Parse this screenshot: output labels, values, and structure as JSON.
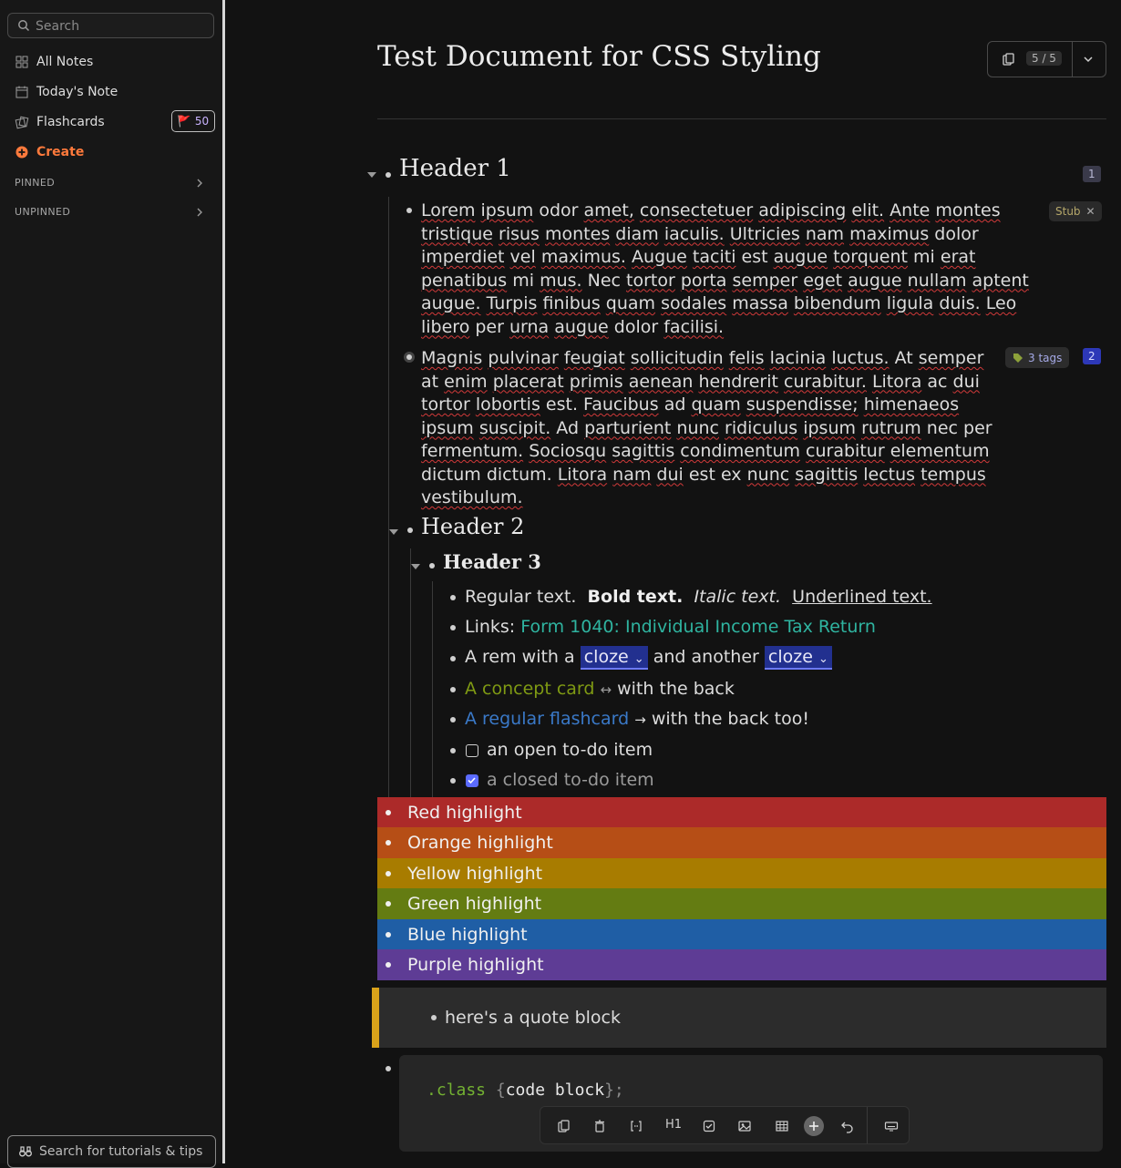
{
  "sidebar": {
    "search_placeholder": "Search",
    "items": [
      {
        "label": "All Notes",
        "icon": "grid-icon"
      },
      {
        "label": "Today's Note",
        "icon": "calendar-icon"
      },
      {
        "label": "Flashcards",
        "icon": "cards-icon"
      },
      {
        "label": "Create",
        "icon": "plus-circle-icon"
      }
    ],
    "flashcard_badge": "50",
    "sections": [
      "PINNED",
      "UNPINNED"
    ],
    "tutorials": "Search for tutorials & tips"
  },
  "document": {
    "title": "Test Document for CSS Styling",
    "card_count": "5 / 5",
    "h1": "Header 1",
    "h1_count": "1",
    "p1_words": [
      "Lorem",
      "ipsum",
      "odor",
      "amet,",
      "consectetuer",
      "adipiscing",
      "elit.",
      "Ante",
      "montes",
      "tristique",
      "risus",
      "montes",
      "diam",
      "iaculis.",
      "Ultricies",
      "nam",
      "maximus",
      "dolor",
      "imperdiet",
      "vel",
      "maximus.",
      "Augue",
      "taciti",
      "est",
      "augue",
      "torquent",
      "mi",
      "erat",
      "penatibus",
      "mi",
      "mus.",
      "Nec",
      "tortor",
      "porta",
      "semper",
      "eget",
      "augue",
      "nullam",
      "aptent",
      "augue.",
      "Turpis",
      "finibus",
      "quam",
      "sodales",
      "massa",
      "bibendum",
      "ligula",
      "duis.",
      "Leo",
      "libero",
      "per",
      "urna",
      "augue",
      "dolor",
      "facilisi."
    ],
    "p1_tag": "Stub",
    "p2_words": [
      "Magnis",
      "pulvinar",
      "feugiat",
      "sollicitudin",
      "felis",
      "lacinia",
      "luctus.",
      "At",
      "semper",
      "at",
      "enim",
      "placerat",
      "primis",
      "aenean",
      "hendrerit",
      "curabitur.",
      "Litora",
      "ac",
      "dui",
      "tortor",
      "lobortis",
      "est.",
      "Faucibus",
      "ad",
      "quam",
      "suspendisse;",
      "himenaeos",
      "ipsum",
      "suscipit.",
      "Ad",
      "parturient",
      "nunc",
      "ridiculus",
      "ipsum",
      "rutrum",
      "nec",
      "per",
      "fermentum.",
      "Sociosqu",
      "sagittis",
      "condimentum",
      "curabitur",
      "elementum",
      "dictum",
      "dictum.",
      "Litora",
      "nam",
      "dui",
      "est",
      "ex",
      "nunc",
      "sagittis",
      "lectus",
      "tempus",
      "vestibulum."
    ],
    "p2_tags": "3 tags",
    "p2_count": "2",
    "h2": "Header 2",
    "h3": "Header 3",
    "format_line": {
      "regular": "Regular text.",
      "bold": "Bold text.",
      "italic": "Italic text.",
      "underline": "Underlined text."
    },
    "links_prefix": "Links:",
    "link_text": "Form 1040: Individual Income Tax Return",
    "cloze_line": {
      "a": "A rem with a",
      "cloze1": "cloze",
      "b": "and another",
      "cloze2": "cloze"
    },
    "concept_line": {
      "front": "A concept card",
      "arrow": "↔",
      "back": "with the back"
    },
    "flash_line": {
      "front": "A regular flashcard",
      "arrow": "→",
      "back": "with the back too!"
    },
    "todo_open": "an open to-do item",
    "todo_closed": "a closed to-do item",
    "highlights": [
      {
        "label": "Red highlight",
        "color": "#ac2a29"
      },
      {
        "label": "Orange highlight",
        "color": "#b64e16"
      },
      {
        "label": "Yellow highlight",
        "color": "#a87c00"
      },
      {
        "label": "Green highlight",
        "color": "#647c12"
      },
      {
        "label": "Blue highlight",
        "color": "#1f5ea5"
      },
      {
        "label": "Purple highlight",
        "color": "#5e3c95"
      }
    ],
    "quote": "here's a quote block",
    "code": {
      "selector": ".class",
      "open": "{",
      "body": "code block",
      "close": "};"
    }
  },
  "toolbar": [
    "cards-icon",
    "trash-cards-icon",
    "cloze-icon",
    "H1",
    "checkbox-icon",
    "image-icon",
    "table-icon",
    "add-icon",
    "undo-icon",
    "keyboard-icon"
  ]
}
